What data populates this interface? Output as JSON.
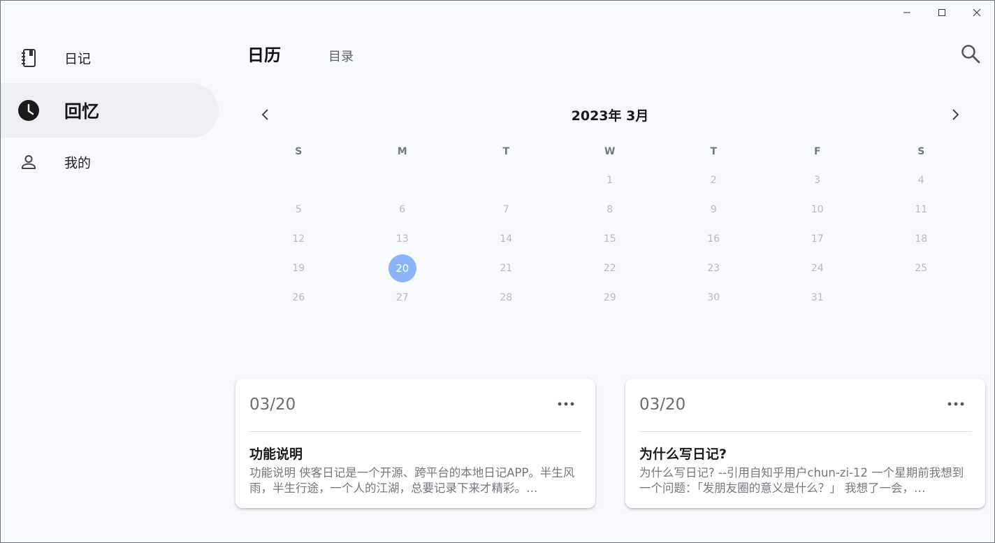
{
  "window": {
    "controls": [
      "minimize-icon",
      "maximize-icon",
      "close-icon"
    ]
  },
  "sidebar": {
    "items": [
      {
        "label": "日记",
        "icon": "notebook-icon",
        "active": false
      },
      {
        "label": "回忆",
        "icon": "clock-icon",
        "active": true
      },
      {
        "label": "我的",
        "icon": "person-icon",
        "active": false
      }
    ]
  },
  "header": {
    "tabs": [
      {
        "label": "日历",
        "active": true
      },
      {
        "label": "目录",
        "active": false
      }
    ],
    "search_icon": "search-icon"
  },
  "calendar": {
    "title": "2023年 3月",
    "weekdays": [
      "S",
      "M",
      "T",
      "W",
      "T",
      "F",
      "S"
    ],
    "weeks": [
      [
        "",
        "",
        "",
        "1",
        "2",
        "3",
        "4"
      ],
      [
        "5",
        "6",
        "7",
        "8",
        "9",
        "10",
        "11"
      ],
      [
        "12",
        "13",
        "14",
        "15",
        "16",
        "17",
        "18"
      ],
      [
        "19",
        "20",
        "21",
        "22",
        "23",
        "24",
        "25"
      ],
      [
        "26",
        "27",
        "28",
        "29",
        "30",
        "31",
        ""
      ]
    ],
    "selected_day": "20",
    "selected_color": "#8ab4f8"
  },
  "cards": [
    {
      "date": "03/20",
      "title": "功能说明",
      "body": "功能说明 侠客日记是一个开源、跨平台的本地日记APP。半生风雨，半生行途，一个人的江湖，总要记录下来才精彩。…"
    },
    {
      "date": "03/20",
      "title": "为什么写日记?",
      "body": "为什么写日记?  --引用自知乎用户chun-zi-12 一个星期前我想到一个问题：「发朋友圈的意义是什么？」 我想了一会，…"
    }
  ]
}
